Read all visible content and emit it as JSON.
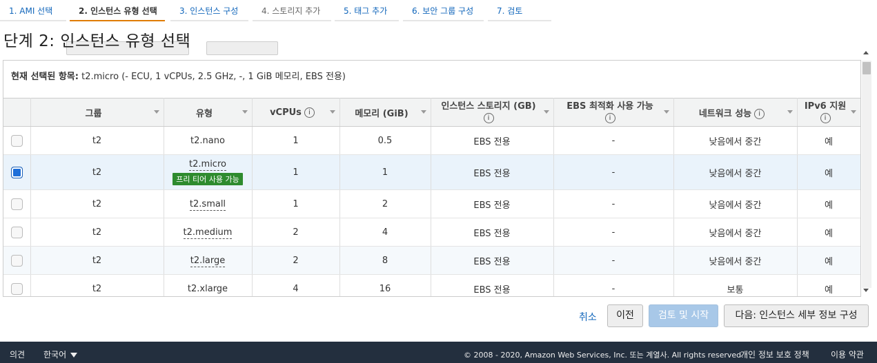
{
  "wizard": {
    "steps": [
      {
        "label": "1. AMI 선택"
      },
      {
        "label": "2. 인스턴스 유형 선택"
      },
      {
        "label": "3. 인스턴스 구성"
      },
      {
        "label": "4. 스토리지 추가"
      },
      {
        "label": "5. 태그 추가"
      },
      {
        "label": "6. 보안 그룹 구성"
      },
      {
        "label": "7. 검토"
      }
    ],
    "page_title": "단계 2: 인스턴스 유형 선택"
  },
  "selection": {
    "prefix": "현재 선택된 항목:",
    "value": "t2.micro (- ECU, 1 vCPUs, 2.5 GHz, -, 1 GiB 메모리, EBS 전용)"
  },
  "table": {
    "headers": {
      "group": "그룹",
      "type": "유형",
      "vcpus": "vCPUs",
      "memory": "메모리 (GiB)",
      "storage": "인스턴스 스토리지 (GB)",
      "ebs": "EBS 최적화 사용 가능",
      "network": "네트워크 성능",
      "ipv6": "IPv6 지원"
    },
    "info_glyph": "i",
    "free_tier_label": "프리 티어 사용 가능",
    "rows": [
      {
        "group": "t2",
        "type": "t2.nano",
        "vcpus": "1",
        "memory": "0.5",
        "storage": "EBS 전용",
        "ebs": "-",
        "network": "낮음에서 중간",
        "ipv6": "예",
        "checked": false
      },
      {
        "group": "t2",
        "type": "t2.micro",
        "vcpus": "1",
        "memory": "1",
        "storage": "EBS 전용",
        "ebs": "-",
        "network": "낮음에서 중간",
        "ipv6": "예",
        "checked": true
      },
      {
        "group": "t2",
        "type": "t2.small",
        "vcpus": "1",
        "memory": "2",
        "storage": "EBS 전용",
        "ebs": "-",
        "network": "낮음에서 중간",
        "ipv6": "예",
        "checked": false
      },
      {
        "group": "t2",
        "type": "t2.medium",
        "vcpus": "2",
        "memory": "4",
        "storage": "EBS 전용",
        "ebs": "-",
        "network": "낮음에서 중간",
        "ipv6": "예",
        "checked": false
      },
      {
        "group": "t2",
        "type": "t2.large",
        "vcpus": "2",
        "memory": "8",
        "storage": "EBS 전용",
        "ebs": "-",
        "network": "낮음에서 중간",
        "ipv6": "예",
        "checked": false
      },
      {
        "group": "t2",
        "type": "t2.xlarge",
        "vcpus": "4",
        "memory": "16",
        "storage": "EBS 전용",
        "ebs": "-",
        "network": "보통",
        "ipv6": "예",
        "checked": false
      }
    ]
  },
  "actions": {
    "cancel": "취소",
    "previous": "이전",
    "review_launch": "검토 및 시작",
    "next": "다음: 인스턴스 세부 정보 구성"
  },
  "footer": {
    "feedback": "의견",
    "language": "한국어",
    "copyright": "© 2008 - 2020, Amazon Web Services, Inc. 또는 계열사. All rights reserved.",
    "privacy": "개인 정보 보호 정책",
    "terms": "이용 약관"
  },
  "colors": {
    "accent": "#e07b00",
    "link": "#1166bb",
    "free_tier": "#2e8b2e",
    "footer_bg": "#232f3e",
    "primary_disabled": "#a8c8e8"
  }
}
